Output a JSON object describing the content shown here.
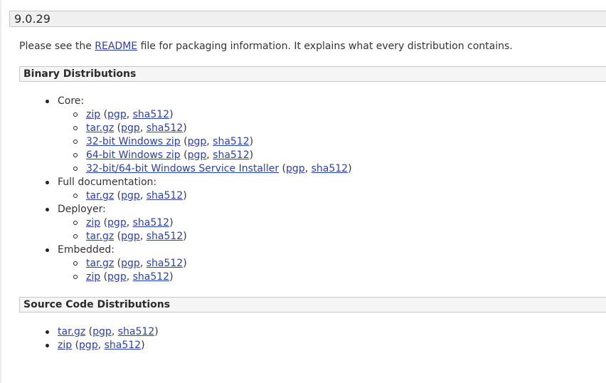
{
  "version": "9.0.29",
  "intro": {
    "before": "Please see the ",
    "link": "README",
    "after": " file for packaging information. It explains what every distribution contains."
  },
  "binary": {
    "title": "Binary Distributions",
    "groups": [
      {
        "label": "Core:",
        "items": [
          {
            "name": "zip",
            "pgp": "pgp",
            "sha": "sha512"
          },
          {
            "name": "tar.gz",
            "pgp": "pgp",
            "sha": "sha512"
          },
          {
            "name": "32-bit Windows zip",
            "pgp": "pgp",
            "sha": "sha512"
          },
          {
            "name": "64-bit Windows zip",
            "pgp": "pgp",
            "sha": "sha512"
          },
          {
            "name": "32-bit/64-bit Windows Service Installer",
            "pgp": "pgp",
            "sha": "sha512"
          }
        ]
      },
      {
        "label": "Full documentation:",
        "items": [
          {
            "name": "tar.gz",
            "pgp": "pgp",
            "sha": "sha512"
          }
        ]
      },
      {
        "label": "Deployer:",
        "items": [
          {
            "name": "zip",
            "pgp": "pgp",
            "sha": "sha512"
          },
          {
            "name": "tar.gz",
            "pgp": "pgp",
            "sha": "sha512"
          }
        ]
      },
      {
        "label": "Embedded:",
        "items": [
          {
            "name": "tar.gz",
            "pgp": "pgp",
            "sha": "sha512"
          },
          {
            "name": "zip",
            "pgp": "pgp",
            "sha": "sha512"
          }
        ]
      }
    ]
  },
  "source": {
    "title": "Source Code Distributions",
    "items": [
      {
        "name": "tar.gz",
        "pgp": "pgp",
        "sha": "sha512"
      },
      {
        "name": "zip",
        "pgp": "pgp",
        "sha": "sha512"
      }
    ]
  }
}
